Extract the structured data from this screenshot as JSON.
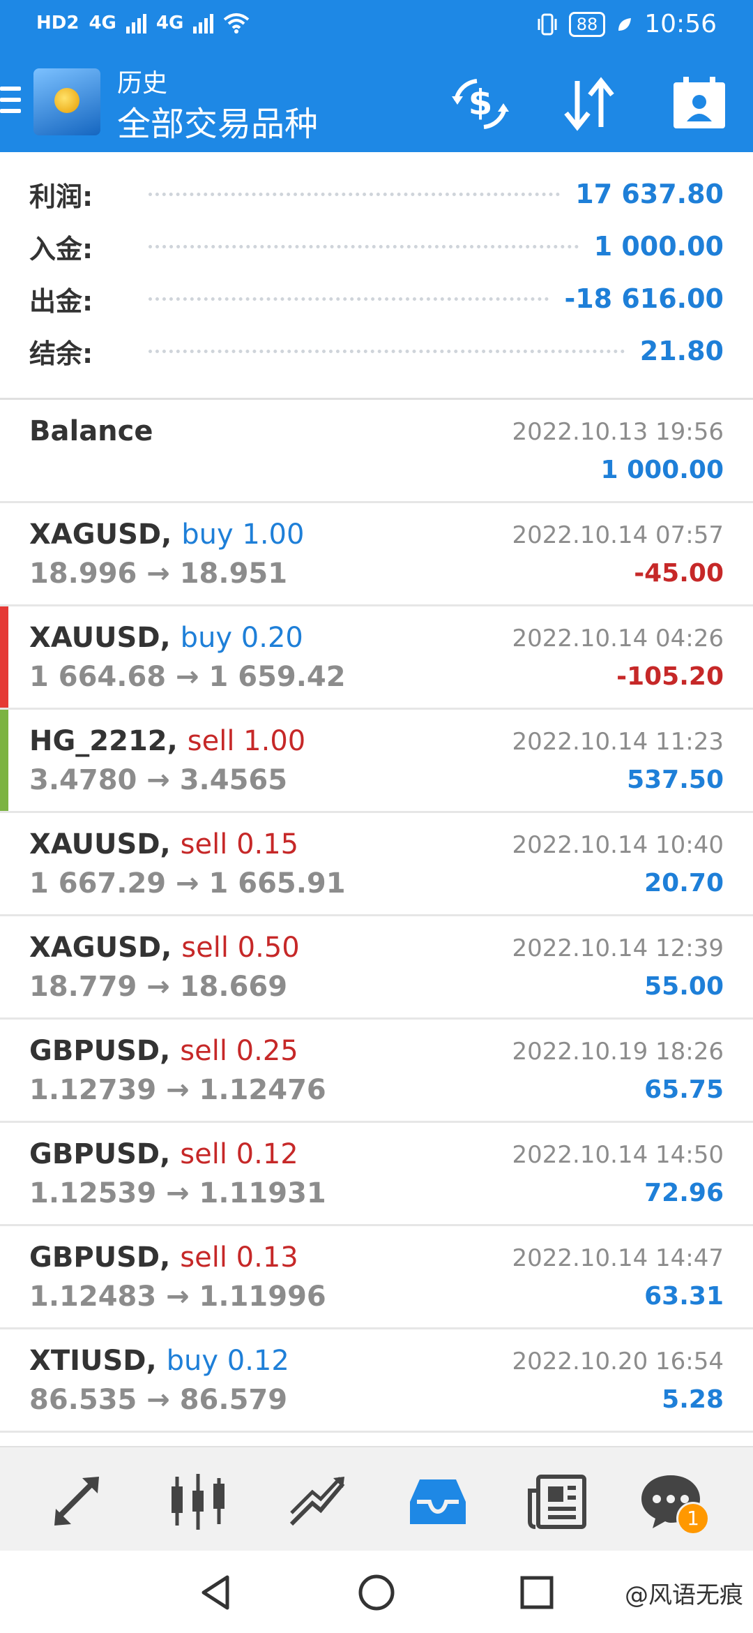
{
  "status_bar": {
    "left": [
      "HD2",
      "4G",
      "4G"
    ],
    "battery": "88",
    "time": "10:56"
  },
  "header": {
    "subtitle": "历史",
    "title": "全部交易品种"
  },
  "summary": [
    {
      "label": "利润:",
      "value": "17 637.80"
    },
    {
      "label": "入金:",
      "value": "1 000.00"
    },
    {
      "label": "出金:",
      "value": "-18 616.00"
    },
    {
      "label": "结余:",
      "value": "21.80"
    }
  ],
  "balance": {
    "label": "Balance",
    "time": "2022.10.13 19:56",
    "amount": "1 000.00"
  },
  "deals": [
    {
      "symbol": "XAGUSD,",
      "side": "buy 1.00",
      "prices": "18.996 → 18.951",
      "time": "2022.10.14 07:57",
      "profit": "-45.00"
    },
    {
      "symbol": "XAUUSD,",
      "side": "buy 0.20",
      "prices": "1 664.68 → 1 659.42",
      "time": "2022.10.14 04:26",
      "profit": "-105.20"
    },
    {
      "symbol": "HG_2212,",
      "side": "sell 1.00",
      "prices": "3.4780 → 3.4565",
      "time": "2022.10.14 11:23",
      "profit": "537.50"
    },
    {
      "symbol": "XAUUSD,",
      "side": "sell 0.15",
      "prices": "1 667.29 → 1 665.91",
      "time": "2022.10.14 10:40",
      "profit": "20.70"
    },
    {
      "symbol": "XAGUSD,",
      "side": "sell 0.50",
      "prices": "18.779 → 18.669",
      "time": "2022.10.14 12:39",
      "profit": "55.00"
    },
    {
      "symbol": "GBPUSD,",
      "side": "sell 0.25",
      "prices": "1.12739 → 1.12476",
      "time": "2022.10.19 18:26",
      "profit": "65.75"
    },
    {
      "symbol": "GBPUSD,",
      "side": "sell 0.12",
      "prices": "1.12539 → 1.11931",
      "time": "2022.10.14 14:50",
      "profit": "72.96"
    },
    {
      "symbol": "GBPUSD,",
      "side": "sell 0.13",
      "prices": "1.12483 → 1.11996",
      "time": "2022.10.14 14:47",
      "profit": "63.31"
    },
    {
      "symbol": "XTIUSD,",
      "side": "buy 0.12",
      "prices": "86.535 → 86.579",
      "time": "2022.10.20 16:54",
      "profit": "5.28"
    }
  ],
  "bottom_nav": {
    "chat_badge": "1"
  },
  "watermark": "@风语无痕",
  "colors": {
    "accent": "#1e88e5",
    "profit": "#1e7fd8",
    "loss": "#c62828",
    "bar_red": "#e53935",
    "bar_green": "#7cb342"
  }
}
